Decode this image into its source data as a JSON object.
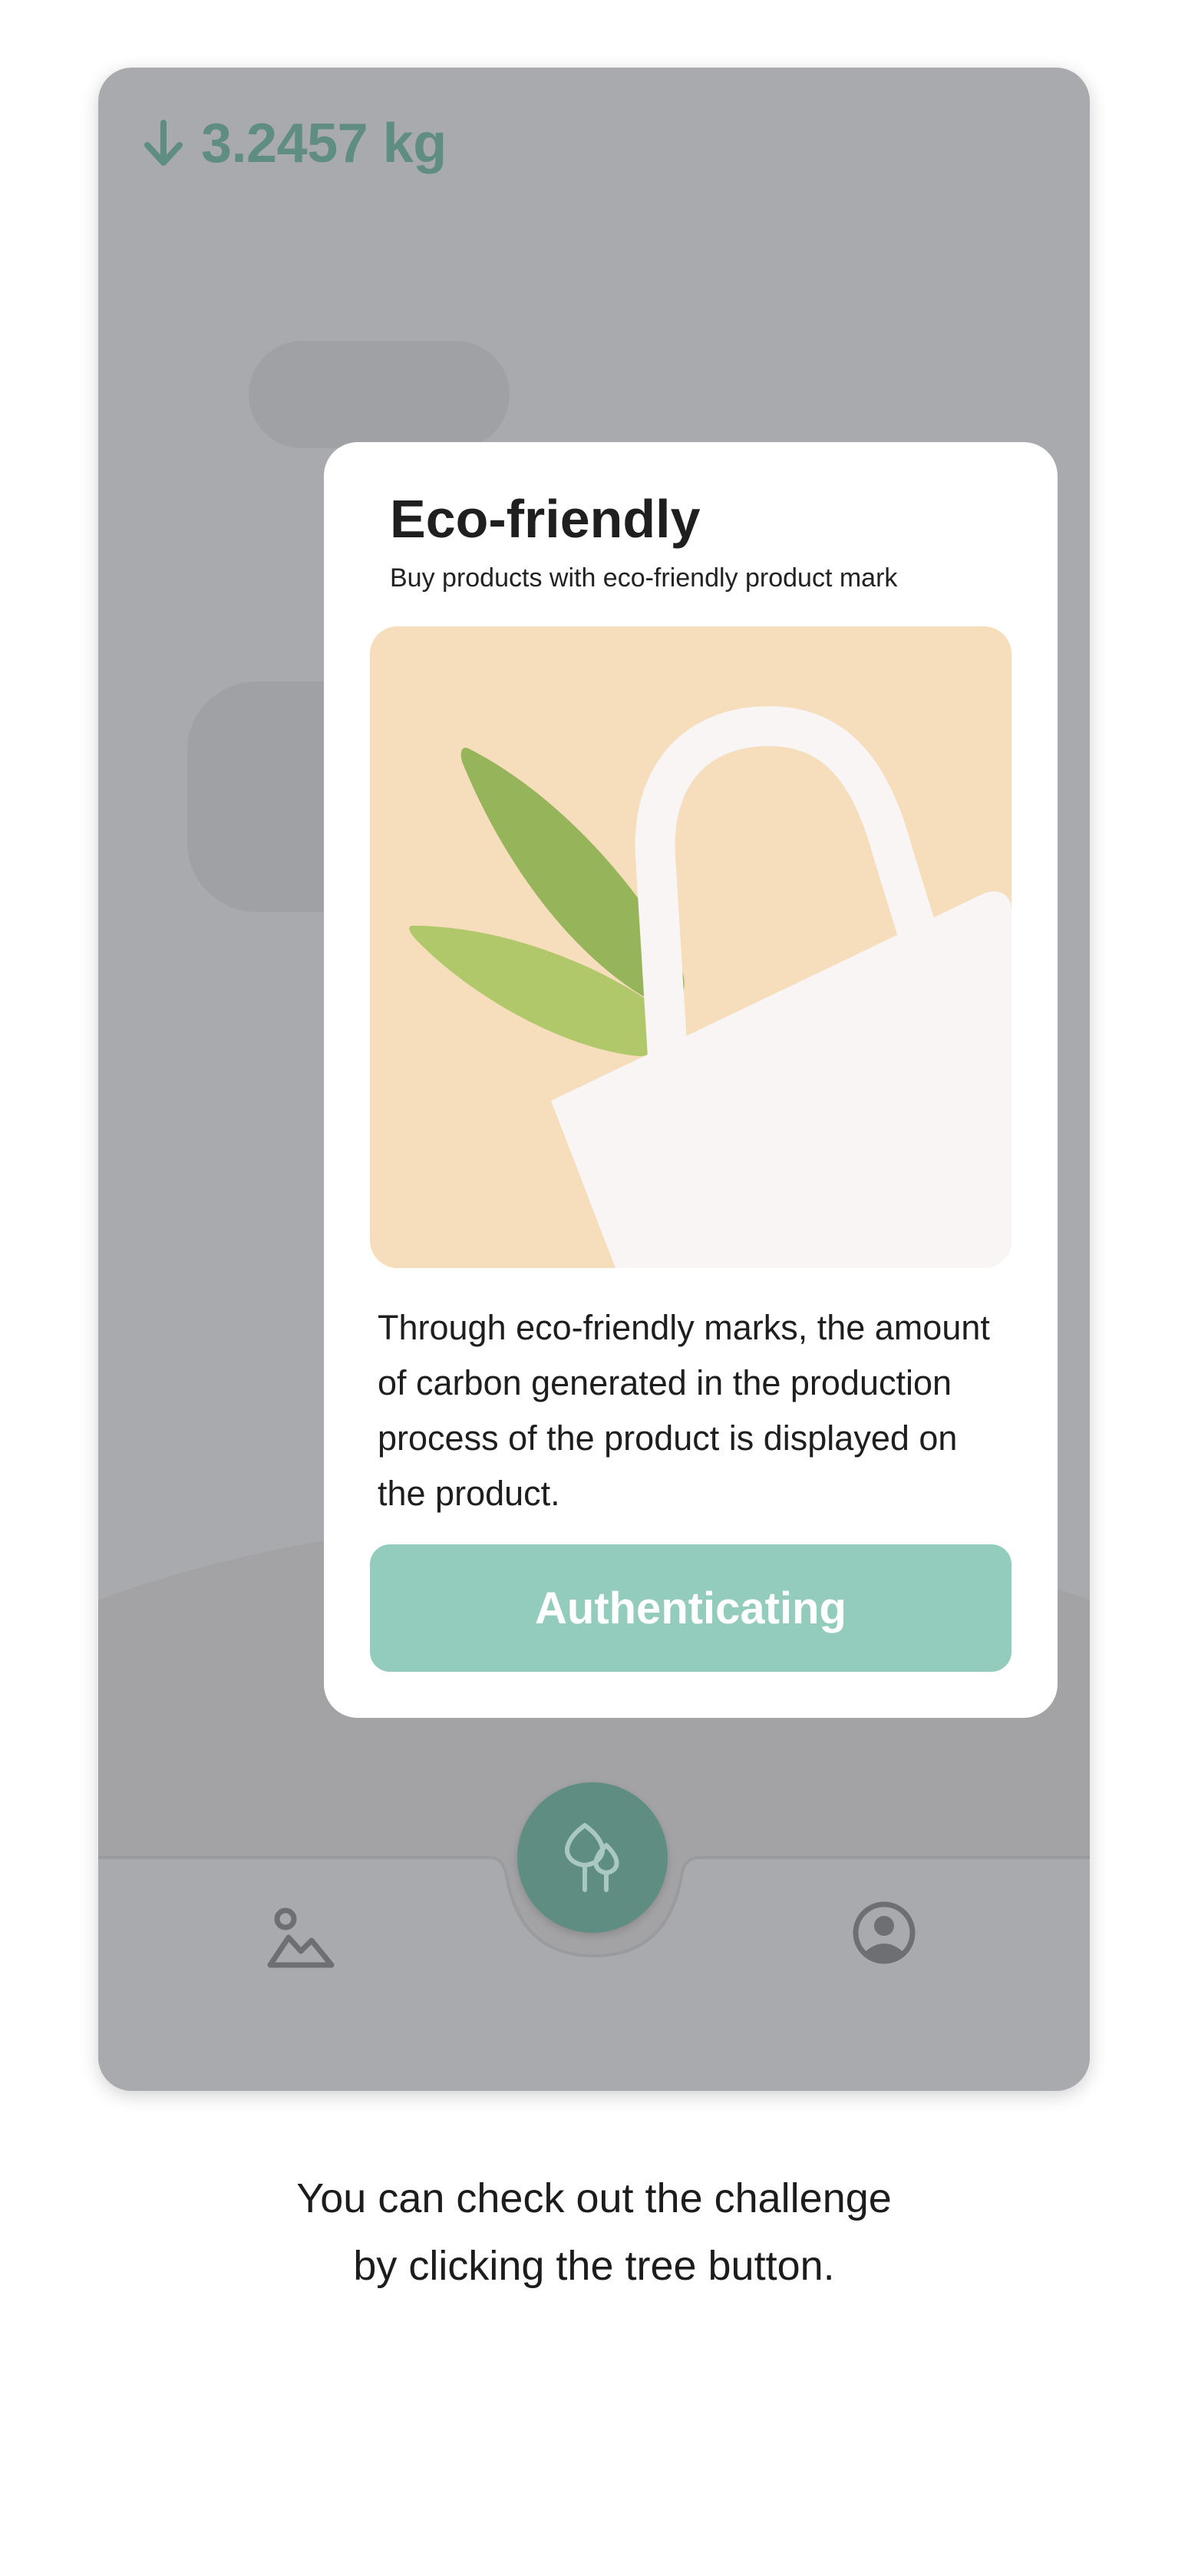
{
  "header": {
    "reduction_value": "3.2457 kg"
  },
  "modal": {
    "title": "Eco-friendly",
    "subtitle": "Buy products with eco-friendly product mark",
    "description": "Through eco-friendly marks, the amount of carbon generated in the production process of the product is displayed on the product.",
    "button_label": "Authenticating",
    "illustration": "eco-bag-with-leaves-illustration"
  },
  "navbar": {
    "left_icon": "map-mountain-icon",
    "center_icon": "tree-icon",
    "right_icon": "profile-icon"
  },
  "caption": {
    "line1": "You can check out the challenge",
    "line2": "by clicking the tree button."
  },
  "colors": {
    "accent": "#5f8d82",
    "button": "#93ccbc",
    "overlay": "#a9aaae",
    "illustration_bg": "#f6ddbb"
  }
}
